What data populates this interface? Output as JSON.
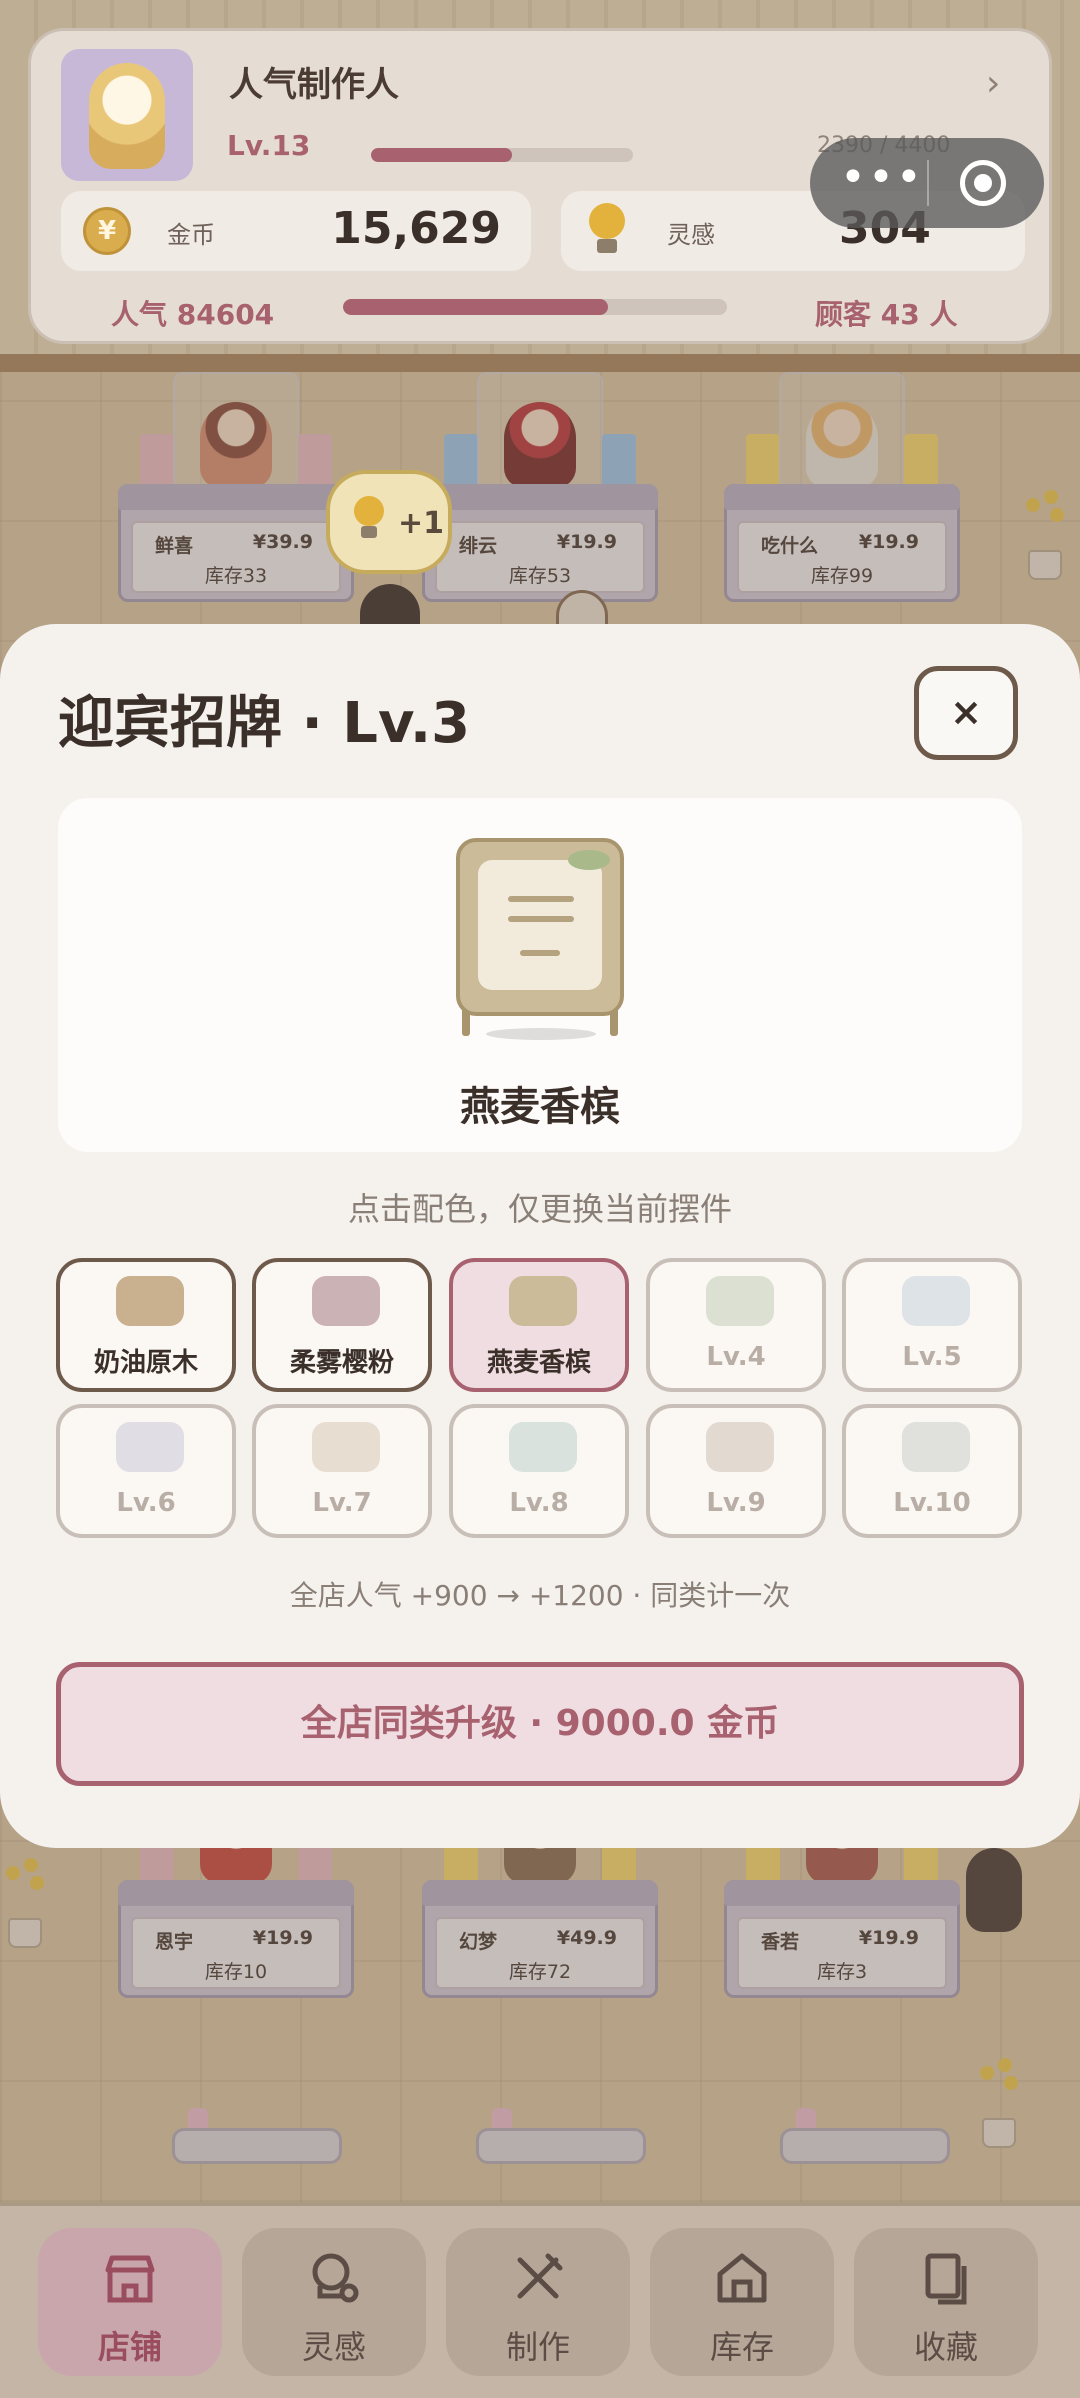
{
  "colors": {
    "accent": "#a8616f",
    "modal_bg": "#f5f2ee",
    "text_dark": "#3b2f2a"
  },
  "header": {
    "title": "人气制作人",
    "level": "Lv.13",
    "xp_text": "2390 / 4400",
    "xp_progress": 0.54,
    "coins_label": "金币",
    "coins_value": "15,629",
    "coin_glyph": "¥",
    "ideas_label": "灵感",
    "ideas_value": "304",
    "popularity_text": "人气 84604",
    "popularity_progress": 0.69,
    "customers_text": "顾客 43 人"
  },
  "capsule": {
    "more_icon": "more-dots-icon",
    "close_icon": "target-icon"
  },
  "idea_bubble": {
    "text": "+1"
  },
  "shelves": [
    {
      "name": "鲜喜",
      "price": "¥39.9",
      "stock": "库存33"
    },
    {
      "name": "绯云",
      "price": "¥19.9",
      "stock": "库存53"
    },
    {
      "name": "吃什么",
      "price": "¥19.9",
      "stock": "库存99"
    },
    {
      "name": "恩宇",
      "price": "¥19.9",
      "stock": "库存10"
    },
    {
      "name": "幻梦",
      "price": "¥49.9",
      "stock": "库存72"
    },
    {
      "name": "香若",
      "price": "¥19.9",
      "stock": "库存3"
    }
  ],
  "modal": {
    "title": "迎宾招牌 · Lv.3",
    "close_label": "×",
    "preview_name": "燕麦香槟",
    "hint": "点击配色，仅更换当前摆件",
    "swatches": [
      {
        "name": "奶油原木",
        "color": "#c9b08f",
        "state": "unlocked"
      },
      {
        "name": "柔雾樱粉",
        "color": "#cbb3b5",
        "state": "unlocked"
      },
      {
        "name": "燕麦香槟",
        "color": "#cbbb98",
        "state": "selected"
      },
      {
        "name": "Lv.4",
        "color": "#dbe0d3",
        "state": "locked"
      },
      {
        "name": "Lv.5",
        "color": "#dde3e6",
        "state": "locked"
      },
      {
        "name": "Lv.6",
        "color": "#e0dde4",
        "state": "locked"
      },
      {
        "name": "Lv.7",
        "color": "#e8ddd1",
        "state": "locked"
      },
      {
        "name": "Lv.8",
        "color": "#d9e2dc",
        "state": "locked"
      },
      {
        "name": "Lv.9",
        "color": "#e2d9d1",
        "state": "locked"
      },
      {
        "name": "Lv.10",
        "color": "#e0e0dc",
        "state": "locked"
      }
    ],
    "bonus_text": "全店人气 +900 → +1200 · 同类计一次",
    "upgrade_label": "全店同类升级 · 9000.0 金币"
  },
  "nav": [
    {
      "label": "店铺",
      "icon": "shop-icon",
      "active": true
    },
    {
      "label": "灵感",
      "icon": "inspiration-icon",
      "active": false
    },
    {
      "label": "制作",
      "icon": "craft-tools-icon",
      "active": false
    },
    {
      "label": "库存",
      "icon": "warehouse-icon",
      "active": false
    },
    {
      "label": "收藏",
      "icon": "collection-icon",
      "active": false
    }
  ]
}
